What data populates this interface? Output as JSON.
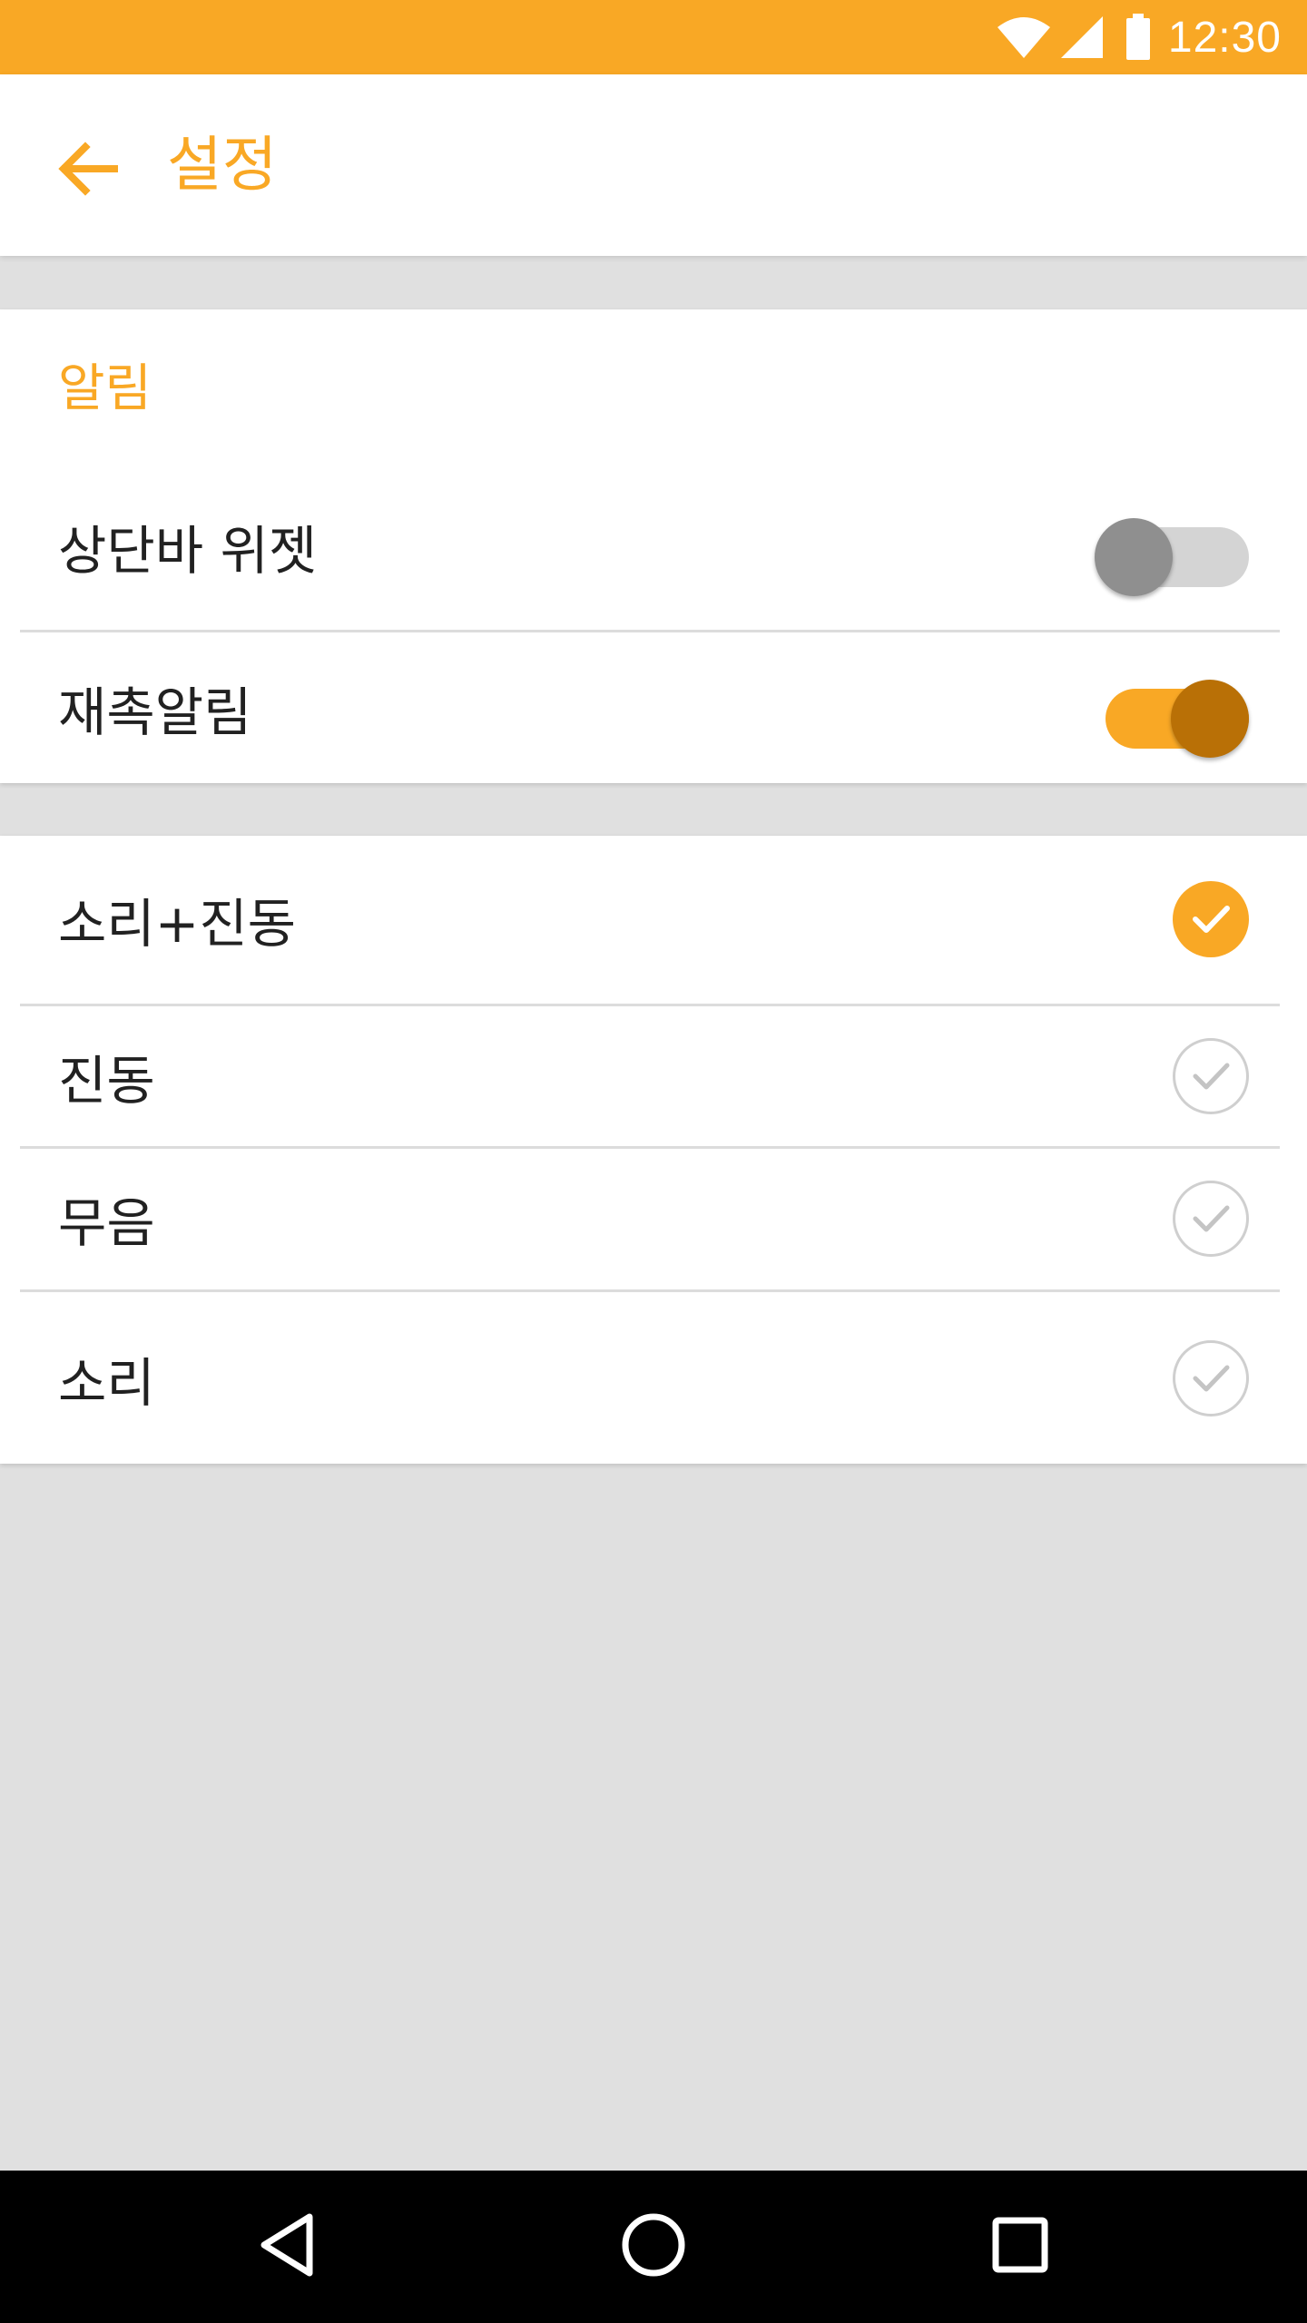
{
  "status_bar": {
    "time": "12:30",
    "color": "#f9a825",
    "icons": [
      "wifi-icon",
      "signal-icon",
      "battery-icon"
    ]
  },
  "app_bar": {
    "title": "설정",
    "back_icon": "arrow-left-icon"
  },
  "notification_section": {
    "header": "알림",
    "items": [
      {
        "label": "상단바 위젯",
        "enabled": false
      },
      {
        "label": "재촉알림",
        "enabled": true
      }
    ]
  },
  "alert_mode_section": {
    "options": [
      {
        "label": "소리+진동",
        "selected": true
      },
      {
        "label": "진동",
        "selected": false
      },
      {
        "label": "무음",
        "selected": false
      },
      {
        "label": "소리",
        "selected": false
      }
    ]
  },
  "nav_bar": {
    "buttons": [
      "back-triangle-icon",
      "home-circle-icon",
      "recents-square-icon"
    ]
  },
  "colors": {
    "accent": "#f9a825",
    "accent_dark": "#b97006",
    "background": "#e0e0e0",
    "text": "#212121"
  }
}
